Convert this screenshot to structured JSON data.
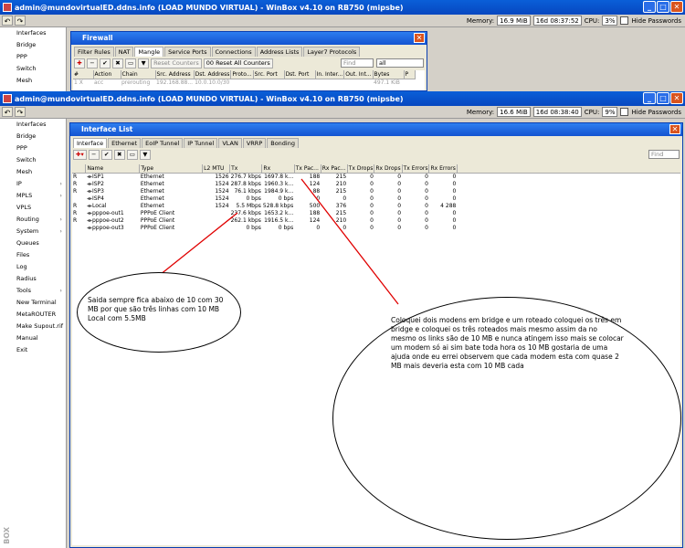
{
  "back_window": {
    "title": "admin@mundovirtualED.ddns.info (LOAD MUNDO VIRTUAL) - WinBox v4.10 on RB750 (mipsbe)",
    "memory": "16.9 MiB",
    "uptime": "16d 08:37:52",
    "cpu": "3%",
    "hide_passwords": "Hide Passwords",
    "sidebar": [
      "Interfaces",
      "Bridge",
      "PPP",
      "Switch",
      "Mesh"
    ],
    "firewall": {
      "title": "Firewall",
      "tabs": [
        "Filter Rules",
        "NAT",
        "Mangle",
        "Service Ports",
        "Connections",
        "Address Lists",
        "Layer7 Protocols"
      ],
      "reset_counters": "Reset Counters",
      "reset_all_counters": "00 Reset All Counters",
      "find_placeholder": "Find",
      "filter_value": "all",
      "columns": [
        "#",
        "Action",
        "Chain",
        "Src. Address",
        "Dst. Address",
        "Proto...",
        "Src. Port",
        "Dst. Port",
        "In. Inter...",
        "Out. Int...",
        "Bytes",
        "P"
      ],
      "row": [
        "1 X",
        "acc",
        "prerouting",
        "192.168.88...",
        "10.0.10.0/30",
        "",
        "",
        "",
        "",
        "",
        "497.1 KiB",
        ""
      ]
    }
  },
  "front_window": {
    "title": "admin@mundovirtualED.ddns.info (LOAD MUNDO VIRTUAL) - WinBox v4.10 on RB750 (mipsbe)",
    "memory": "16.6 MiB",
    "uptime": "16d 08:38:40",
    "cpu": "9%",
    "hide_passwords": "Hide Passwords",
    "sidebar": [
      {
        "label": "Interfaces",
        "arrow": ""
      },
      {
        "label": "Bridge",
        "arrow": ""
      },
      {
        "label": "PPP",
        "arrow": ""
      },
      {
        "label": "Switch",
        "arrow": ""
      },
      {
        "label": "Mesh",
        "arrow": ""
      },
      {
        "label": "IP",
        "arrow": "›"
      },
      {
        "label": "MPLS",
        "arrow": "›"
      },
      {
        "label": "VPLS",
        "arrow": ""
      },
      {
        "label": "Routing",
        "arrow": "›"
      },
      {
        "label": "System",
        "arrow": "›"
      },
      {
        "label": "Queues",
        "arrow": ""
      },
      {
        "label": "Files",
        "arrow": ""
      },
      {
        "label": "Log",
        "arrow": ""
      },
      {
        "label": "Radius",
        "arrow": ""
      },
      {
        "label": "Tools",
        "arrow": "›"
      },
      {
        "label": "New Terminal",
        "arrow": ""
      },
      {
        "label": "MetaROUTER",
        "arrow": ""
      },
      {
        "label": "Make Supout.rif",
        "arrow": ""
      },
      {
        "label": "Manual",
        "arrow": ""
      },
      {
        "label": "Exit",
        "arrow": ""
      }
    ],
    "vertical_label": "BOX",
    "interface_list": {
      "title": "Interface List",
      "tabs": [
        "Interface",
        "Ethernet",
        "EoIP Tunnel",
        "IP Tunnel",
        "VLAN",
        "VRRP",
        "Bonding"
      ],
      "find_placeholder": "Find",
      "columns": [
        "",
        "Name",
        "Type",
        "L2 MTU",
        "Tx",
        "Rx",
        "Tx Pac...",
        "Rx Pac...",
        "Tx Drops",
        "Rx Drops",
        "Tx Errors",
        "Rx Errors"
      ],
      "rows": [
        [
          "R",
          "ISP1",
          "Ethernet",
          "1526",
          "276.7 kbps",
          "1697.8 k...",
          "188",
          "215",
          "0",
          "0",
          "0",
          "0"
        ],
        [
          "R",
          "ISP2",
          "Ethernet",
          "1524",
          "287.8 kbps",
          "1960.3 k...",
          "124",
          "210",
          "0",
          "0",
          "0",
          "0"
        ],
        [
          "R",
          "ISP3",
          "Ethernet",
          "1524",
          "76.1 kbps",
          "1984.9 k...",
          "88",
          "215",
          "0",
          "0",
          "0",
          "0"
        ],
        [
          "",
          "ISP4",
          "Ethernet",
          "1524",
          "0 bps",
          "0 bps",
          "0",
          "0",
          "0",
          "0",
          "0",
          "0"
        ],
        [
          "R",
          "Local",
          "Ethernet",
          "1524",
          "5.5 Mbps",
          "528.8 kbps",
          "500",
          "376",
          "0",
          "0",
          "0",
          "4 288"
        ],
        [
          "R",
          "pppoe-out1",
          "PPPoE Client",
          "",
          "237.6 kbps",
          "1653.2 k...",
          "188",
          "215",
          "0",
          "0",
          "0",
          "0"
        ],
        [
          "R",
          "pppoe-out2",
          "PPPoE Client",
          "",
          "262.1 kbps",
          "1916.5 k...",
          "124",
          "210",
          "0",
          "0",
          "0",
          "0"
        ],
        [
          "",
          "pppoe-out3",
          "PPPoE Client",
          "",
          "0 bps",
          "0 bps",
          "0",
          "0",
          "0",
          "0",
          "0",
          "0"
        ]
      ]
    }
  },
  "annotations": {
    "left_text": "Saida sempre fica abaixo de 10 com 30 MB por que são três linhas com 10 MB Local com 5.5MB",
    "right_text": "Coloquei dois modens em bridge e um roteado coloquei os três em bridge e coloquei os três roteados mais mesmo assim da no mesmo os links são de 10 MB e nunca atingem isso mais se colocar um modem só ai sim bate toda hora os 10 MB gostaria de uma ajuda onde eu errei  observem que cada modem esta com quase 2 MB mais deveria esta com 10 MB cada"
  }
}
